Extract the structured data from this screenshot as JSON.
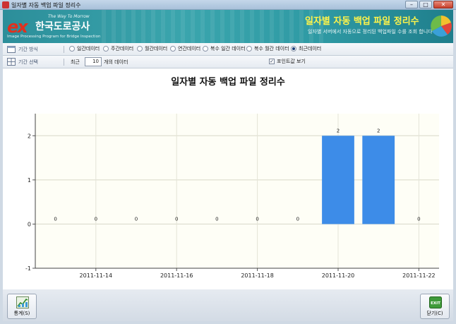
{
  "window": {
    "title": "일자별 자동 백업 파일 정리수",
    "controls": {
      "minimize": "–",
      "maximize": "□",
      "close": "✕"
    }
  },
  "header": {
    "logo_text": "ex",
    "tagline": "The Way To Morrow",
    "company": "한국도로공사",
    "program": "Image Processing Program for Bridge Inspection",
    "title": "일자별 자동 백업 파일 정리수",
    "description": "일자별 서버에서 자동으로 정리된 백업파일 수를 조회 합니다",
    "brand_color": "#2c8e9a",
    "title_color": "#fff44a"
  },
  "period_type": {
    "label": "기간 방식",
    "options": [
      {
        "label": "일간데이터",
        "selected": false
      },
      {
        "label": "주간데이터",
        "selected": false
      },
      {
        "label": "월간데이터",
        "selected": false
      },
      {
        "label": "연간데이터",
        "selected": false
      },
      {
        "label": "복수 일간 데이터",
        "selected": false
      },
      {
        "label": "복수 월간 데이터",
        "selected": false
      },
      {
        "label": "최근데이터",
        "selected": true
      }
    ]
  },
  "period_select": {
    "label": "기간 선택",
    "recent_label": "최근",
    "recent_value": "10",
    "recent_unit": "개의 데이터",
    "point_label_checkbox": {
      "label": "포인트값 보기",
      "checked": true
    }
  },
  "chart_data": {
    "type": "bar",
    "title": "일자별 자동 백업 파일 정리수",
    "x": [
      "2011-11-13",
      "2011-11-14",
      "2011-11-15",
      "2011-11-16",
      "2011-11-17",
      "2011-11-18",
      "2011-11-19",
      "2011-11-20",
      "2011-11-21",
      "2011-11-22"
    ],
    "values": [
      0,
      0,
      0,
      0,
      0,
      0,
      0,
      2,
      2,
      0
    ],
    "x_tick_labels": [
      "2011-11-14",
      "2011-11-16",
      "2011-11-18",
      "2011-11-20",
      "2011-11-22"
    ],
    "y_tick_labels": [
      "2",
      "1",
      "0",
      "-1"
    ],
    "ylim": [
      -1,
      2.5
    ],
    "y_ticks": [
      2,
      1,
      0,
      -1
    ],
    "bar_color": "#3d8ce8",
    "plot_background": "#fefef6",
    "grid": true,
    "data_labels": true
  },
  "footer": {
    "stats_button": "통계(S)",
    "close_button": "닫기(C)",
    "exit_icon_text": "EXIT"
  }
}
